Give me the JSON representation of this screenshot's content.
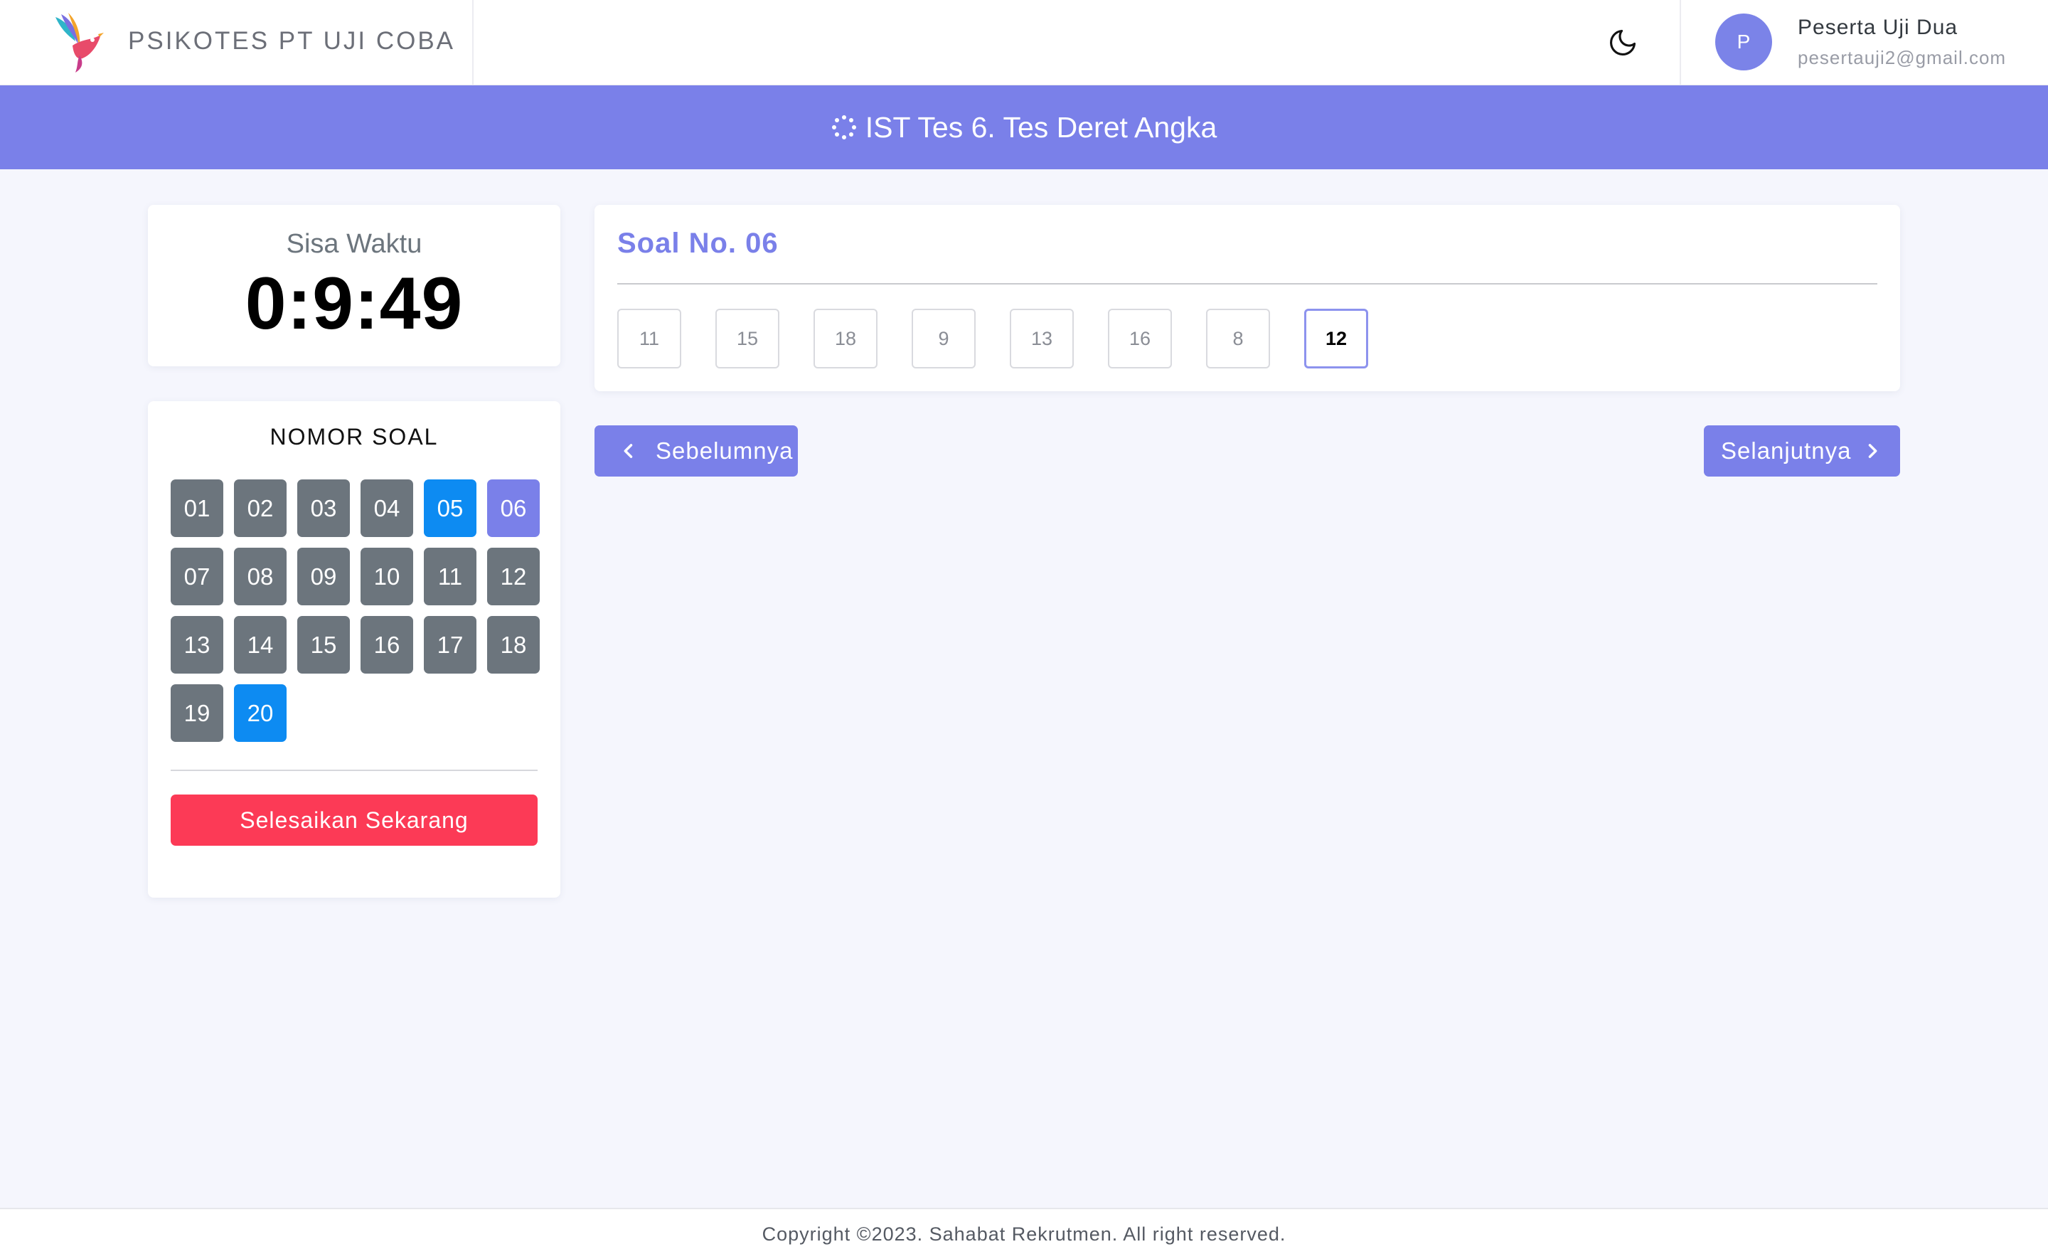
{
  "header": {
    "brand_name": "PSIKOTES PT UJI COBA",
    "user": {
      "initial": "P",
      "name": "Peserta Uji Dua",
      "email": "pesertauji2@gmail.com"
    }
  },
  "titlebar": {
    "title": "IST Tes 6. Tes Deret Angka"
  },
  "timer": {
    "label": "Sisa Waktu",
    "value": "0:9:49"
  },
  "question_nav": {
    "title": "NOMOR SOAL",
    "numbers": [
      "01",
      "02",
      "03",
      "04",
      "05",
      "06",
      "07",
      "08",
      "09",
      "10",
      "11",
      "12",
      "13",
      "14",
      "15",
      "16",
      "17",
      "18",
      "19",
      "20"
    ],
    "answered": [
      "05",
      "20"
    ],
    "active": "06",
    "finish_label": "Selesaikan Sekarang"
  },
  "question": {
    "title": "Soal No. 06",
    "options": [
      "11",
      "15",
      "18",
      "9",
      "13",
      "16",
      "8",
      "12"
    ],
    "selected": "12"
  },
  "navigation": {
    "prev_label": "Sebelumnya",
    "next_label": "Selanjutnya"
  },
  "footer": {
    "copyright": "Copyright ©2023. Sahabat Rekrutmen. All right reserved."
  },
  "colors": {
    "primary": "#7a80e9",
    "answered": "#0d8bf2",
    "unanswered": "#6c757d",
    "danger": "#fc3a56",
    "background": "#f5f6fd"
  }
}
